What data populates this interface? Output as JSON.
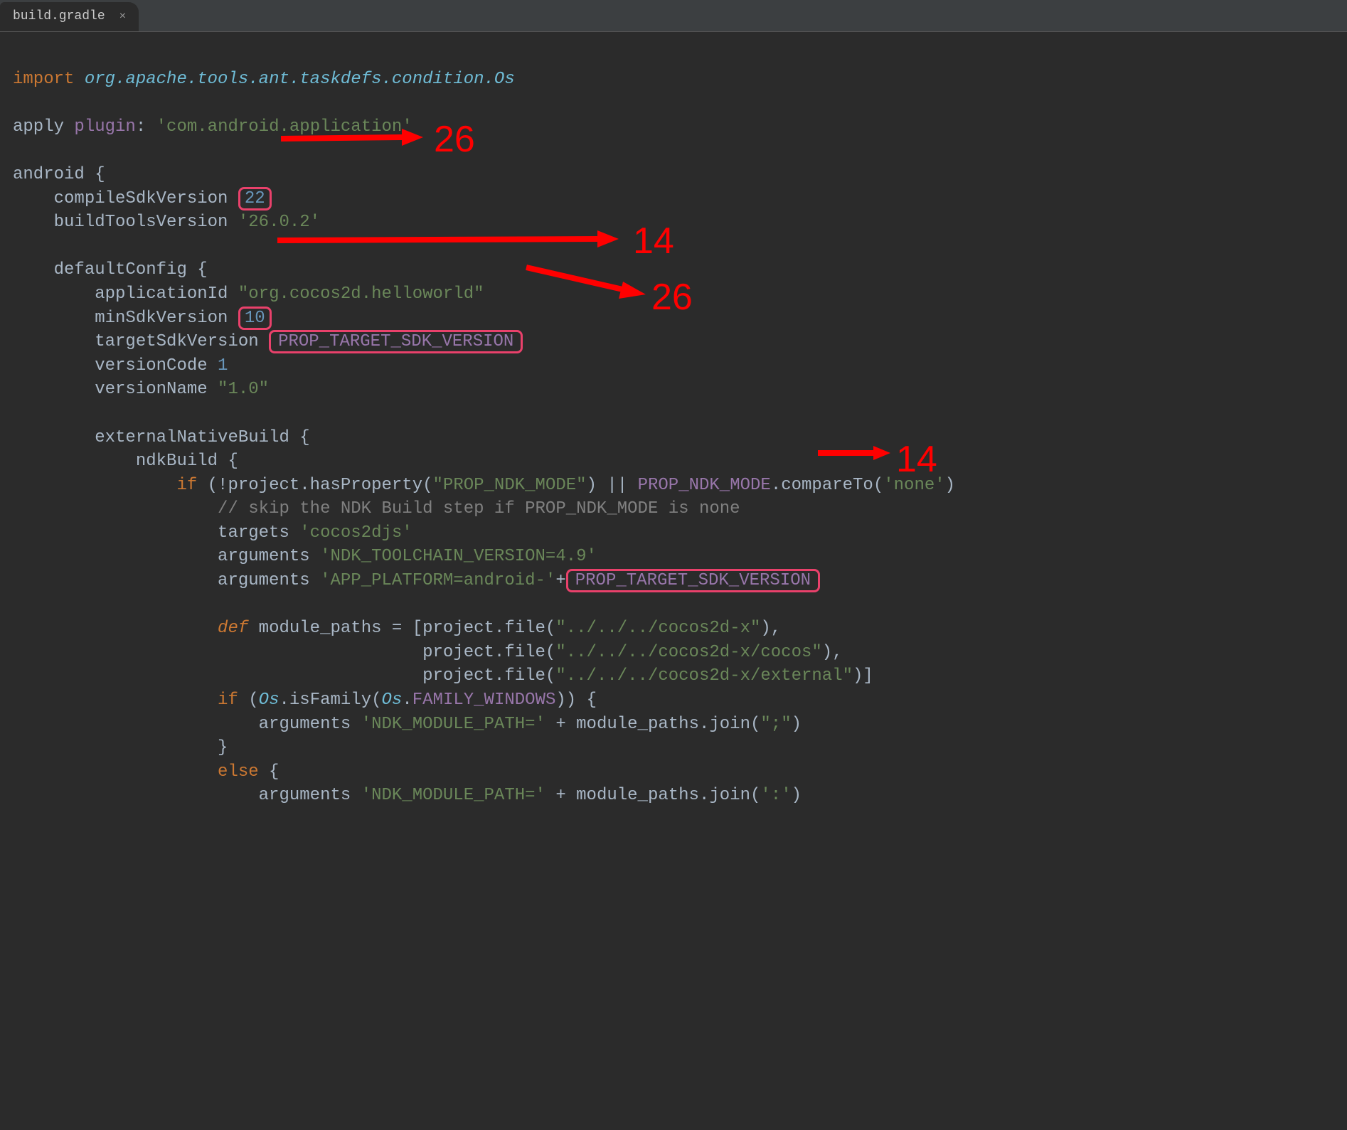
{
  "tab": {
    "label": "build.gradle",
    "close_glyph": "×"
  },
  "annotations": {
    "a1": "26",
    "a2": "14",
    "a3": "26",
    "a4": "14"
  },
  "code": {
    "line1_import": "import",
    "line1_pkg": "org.apache.tools.ant.taskdefs.condition.Os",
    "line3_apply": "apply ",
    "line3_plugin": "plugin",
    "line3_colon": ": ",
    "line3_val": "'com.android.application'",
    "line5_android": "android {",
    "line6_label": "compileSdkVersion ",
    "line6_val": "22",
    "line7_label": "buildToolsVersion ",
    "line7_val": "'26.0.2'",
    "line9": "defaultConfig {",
    "line10_label": "applicationId ",
    "line10_val": "\"org.cocos2d.helloworld\"",
    "line11_label": "minSdkVersion ",
    "line11_val": "10",
    "line12_label": "targetSdkVersion ",
    "line12_val": "PROP_TARGET_SDK_VERSION",
    "line13_label": "versionCode ",
    "line13_val": "1",
    "line14_label": "versionName ",
    "line14_val": "\"1.0\"",
    "line16": "externalNativeBuild {",
    "line17": "ndkBuild {",
    "line18_if": "if",
    "line18_open": " (!project.hasProperty(",
    "line18_str": "\"PROP_NDK_MODE\"",
    "line18_close": ") || ",
    "line18_const": "PROP_NDK_MODE",
    "line18_rest": ".compareTo(",
    "line18_none": "'none'",
    "line18_end": ")",
    "line19_cmt": "// skip the NDK Build step if PROP_NDK_MODE is none",
    "line20_label": "targets ",
    "line20_val": "'cocos2djs'",
    "line21_label": "arguments ",
    "line21_val": "'NDK_TOOLCHAIN_VERSION=4.9'",
    "line22_label": "arguments ",
    "line22_val1": "'APP_PLATFORM=android-'",
    "line22_plus": "+",
    "line22_const": "PROP_TARGET_SDK_VERSION",
    "line24_def": "def",
    "line24_rest": " module_paths = [project.file(",
    "line24_str": "\"../../../cocos2d-x\"",
    "line24_end": "),",
    "line25_pre": "project.file(",
    "line25_str": "\"../../../cocos2d-x/cocos\"",
    "line25_end": "),",
    "line26_pre": "project.file(",
    "line26_str": "\"../../../cocos2d-x/external\"",
    "line26_end": ")]",
    "line27_if": "if",
    "line27_open": " (",
    "line27_os": "Os",
    "line27_isf": ".isFamily(",
    "line27_os2": "Os",
    "line27_fw": ".",
    "line27_const": "FAMILY_WINDOWS",
    "line27_close": ")) {",
    "line28_label": "arguments ",
    "line28_str": "'NDK_MODULE_PATH='",
    "line28_plus": " + module_paths.join(",
    "line28_semi": "\";\"",
    "line28_end": ")",
    "line29": "}",
    "line30_else": "else",
    "line30_brace": " {",
    "line31_label": "arguments ",
    "line31_str": "'NDK_MODULE_PATH='",
    "line31_plus": " + module_paths.join(",
    "line31_colon": "':'",
    "line31_end": ")"
  }
}
